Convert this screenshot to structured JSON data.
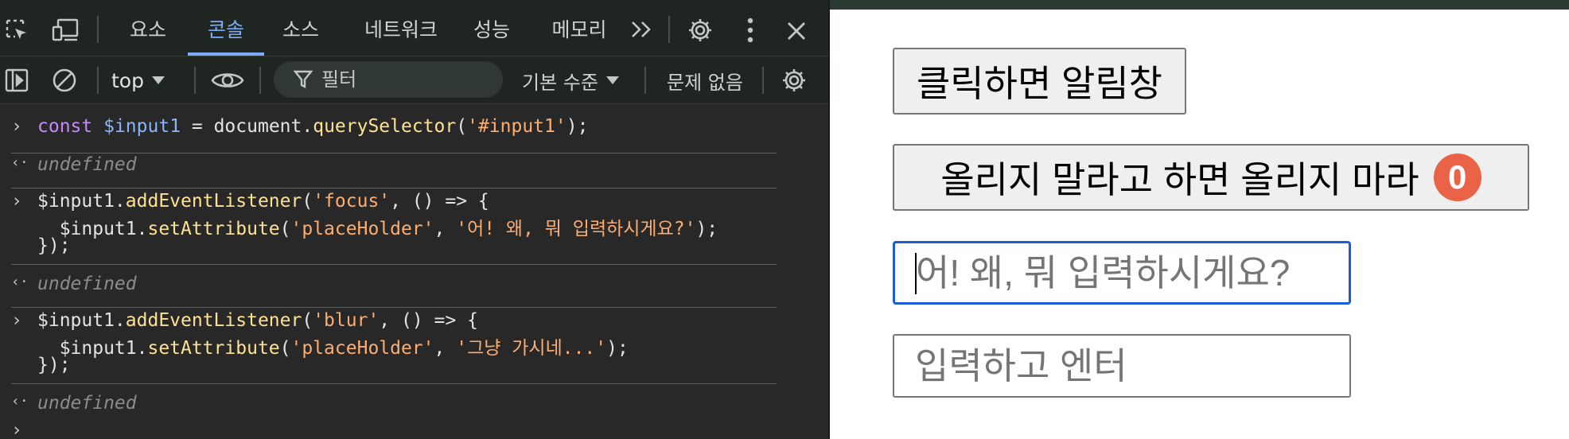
{
  "devtools": {
    "tabs": [
      {
        "label": "요소",
        "active": false
      },
      {
        "label": "콘솔",
        "active": true
      },
      {
        "label": "소스",
        "active": false
      },
      {
        "label": "네트워크",
        "active": false
      },
      {
        "label": "성능",
        "active": false
      },
      {
        "label": "메모리",
        "active": false
      }
    ],
    "context": "top",
    "filter_placeholder": "필터",
    "levels_label": "기본 수준",
    "issues_label": "문제 없음",
    "icons": [
      "inspect-icon",
      "device-toggle-icon",
      "more-tabs-icon",
      "settings-icon",
      "kebab-menu-icon",
      "close-icon",
      "sidebar-toggle-icon",
      "clear-console-icon",
      "eye-icon",
      "filter-icon",
      "console-settings-icon"
    ],
    "colors": {
      "background": "#282828",
      "toolbar": "#1f2621",
      "accent": "#7cacf8",
      "keyword": "#c58af9",
      "variable": "#8ab4f8",
      "function": "#fde293",
      "string": "#f28b82"
    }
  },
  "console": {
    "entry1": {
      "l1": {
        "t1": "const",
        "t2": " ",
        "t3": "$input1",
        "t4": " = document.",
        "t5": "querySelector",
        "t6": "(",
        "t7": "'#input1'",
        "t8": ");"
      }
    },
    "result1": "undefined",
    "entry2": {
      "l1": {
        "t1": "$input1.",
        "t2": "addEventListener",
        "t3": "(",
        "t4": "'focus'",
        "t5": ", () => {"
      },
      "l2": {
        "t1": "  $input1.",
        "t2": "setAttribute",
        "t3": "(",
        "t4": "'placeHolder'",
        "t5": ", ",
        "t6": "'어! 왜, 뭐 입력하시게요?'",
        "t7": ");"
      },
      "l3": "});"
    },
    "result2": "undefined",
    "entry3": {
      "l1": {
        "t1": "$input1.",
        "t2": "addEventListener",
        "t3": "(",
        "t4": "'blur'",
        "t5": ", () => {"
      },
      "l2": {
        "t1": "  $input1.",
        "t2": "setAttribute",
        "t3": "(",
        "t4": "'placeHolder'",
        "t5": ", ",
        "t6": "'그냥 가시네...'",
        "t7": ");"
      },
      "l3": "});"
    },
    "result3": "undefined",
    "prompt_glyph": "›",
    "result_glyph": "‹·"
  },
  "page": {
    "alert_button_label": "클릭하면 알림창",
    "no_upload_button_label": "올리지 말라고 하면 올리지 마라",
    "no_upload_count": "0",
    "input1_placeholder": "어! 왜, 뭐 입력하시게요?",
    "input1_value": "",
    "input2_placeholder": "입력하고 엔터",
    "input2_value": "",
    "colors": {
      "badge": "#ea6346",
      "focus_ring": "#1a5dd6"
    }
  }
}
